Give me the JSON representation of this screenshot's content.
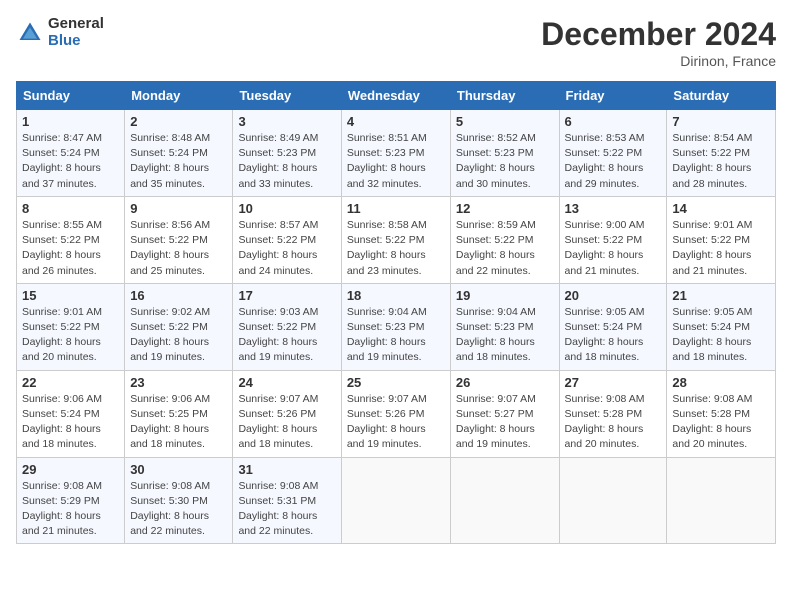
{
  "header": {
    "logo_general": "General",
    "logo_blue": "Blue",
    "month": "December 2024",
    "location": "Dirinon, France"
  },
  "weekdays": [
    "Sunday",
    "Monday",
    "Tuesday",
    "Wednesday",
    "Thursday",
    "Friday",
    "Saturday"
  ],
  "weeks": [
    [
      {
        "day": "1",
        "sunrise": "8:47 AM",
        "sunset": "5:24 PM",
        "daylight": "8 hours and 37 minutes."
      },
      {
        "day": "2",
        "sunrise": "8:48 AM",
        "sunset": "5:24 PM",
        "daylight": "8 hours and 35 minutes."
      },
      {
        "day": "3",
        "sunrise": "8:49 AM",
        "sunset": "5:23 PM",
        "daylight": "8 hours and 33 minutes."
      },
      {
        "day": "4",
        "sunrise": "8:51 AM",
        "sunset": "5:23 PM",
        "daylight": "8 hours and 32 minutes."
      },
      {
        "day": "5",
        "sunrise": "8:52 AM",
        "sunset": "5:23 PM",
        "daylight": "8 hours and 30 minutes."
      },
      {
        "day": "6",
        "sunrise": "8:53 AM",
        "sunset": "5:22 PM",
        "daylight": "8 hours and 29 minutes."
      },
      {
        "day": "7",
        "sunrise": "8:54 AM",
        "sunset": "5:22 PM",
        "daylight": "8 hours and 28 minutes."
      }
    ],
    [
      {
        "day": "8",
        "sunrise": "8:55 AM",
        "sunset": "5:22 PM",
        "daylight": "8 hours and 26 minutes."
      },
      {
        "day": "9",
        "sunrise": "8:56 AM",
        "sunset": "5:22 PM",
        "daylight": "8 hours and 25 minutes."
      },
      {
        "day": "10",
        "sunrise": "8:57 AM",
        "sunset": "5:22 PM",
        "daylight": "8 hours and 24 minutes."
      },
      {
        "day": "11",
        "sunrise": "8:58 AM",
        "sunset": "5:22 PM",
        "daylight": "8 hours and 23 minutes."
      },
      {
        "day": "12",
        "sunrise": "8:59 AM",
        "sunset": "5:22 PM",
        "daylight": "8 hours and 22 minutes."
      },
      {
        "day": "13",
        "sunrise": "9:00 AM",
        "sunset": "5:22 PM",
        "daylight": "8 hours and 21 minutes."
      },
      {
        "day": "14",
        "sunrise": "9:01 AM",
        "sunset": "5:22 PM",
        "daylight": "8 hours and 21 minutes."
      }
    ],
    [
      {
        "day": "15",
        "sunrise": "9:01 AM",
        "sunset": "5:22 PM",
        "daylight": "8 hours and 20 minutes."
      },
      {
        "day": "16",
        "sunrise": "9:02 AM",
        "sunset": "5:22 PM",
        "daylight": "8 hours and 19 minutes."
      },
      {
        "day": "17",
        "sunrise": "9:03 AM",
        "sunset": "5:22 PM",
        "daylight": "8 hours and 19 minutes."
      },
      {
        "day": "18",
        "sunrise": "9:04 AM",
        "sunset": "5:23 PM",
        "daylight": "8 hours and 19 minutes."
      },
      {
        "day": "19",
        "sunrise": "9:04 AM",
        "sunset": "5:23 PM",
        "daylight": "8 hours and 18 minutes."
      },
      {
        "day": "20",
        "sunrise": "9:05 AM",
        "sunset": "5:24 PM",
        "daylight": "8 hours and 18 minutes."
      },
      {
        "day": "21",
        "sunrise": "9:05 AM",
        "sunset": "5:24 PM",
        "daylight": "8 hours and 18 minutes."
      }
    ],
    [
      {
        "day": "22",
        "sunrise": "9:06 AM",
        "sunset": "5:24 PM",
        "daylight": "8 hours and 18 minutes."
      },
      {
        "day": "23",
        "sunrise": "9:06 AM",
        "sunset": "5:25 PM",
        "daylight": "8 hours and 18 minutes."
      },
      {
        "day": "24",
        "sunrise": "9:07 AM",
        "sunset": "5:26 PM",
        "daylight": "8 hours and 18 minutes."
      },
      {
        "day": "25",
        "sunrise": "9:07 AM",
        "sunset": "5:26 PM",
        "daylight": "8 hours and 19 minutes."
      },
      {
        "day": "26",
        "sunrise": "9:07 AM",
        "sunset": "5:27 PM",
        "daylight": "8 hours and 19 minutes."
      },
      {
        "day": "27",
        "sunrise": "9:08 AM",
        "sunset": "5:28 PM",
        "daylight": "8 hours and 20 minutes."
      },
      {
        "day": "28",
        "sunrise": "9:08 AM",
        "sunset": "5:28 PM",
        "daylight": "8 hours and 20 minutes."
      }
    ],
    [
      {
        "day": "29",
        "sunrise": "9:08 AM",
        "sunset": "5:29 PM",
        "daylight": "8 hours and 21 minutes."
      },
      {
        "day": "30",
        "sunrise": "9:08 AM",
        "sunset": "5:30 PM",
        "daylight": "8 hours and 22 minutes."
      },
      {
        "day": "31",
        "sunrise": "9:08 AM",
        "sunset": "5:31 PM",
        "daylight": "8 hours and 22 minutes."
      },
      null,
      null,
      null,
      null
    ]
  ]
}
